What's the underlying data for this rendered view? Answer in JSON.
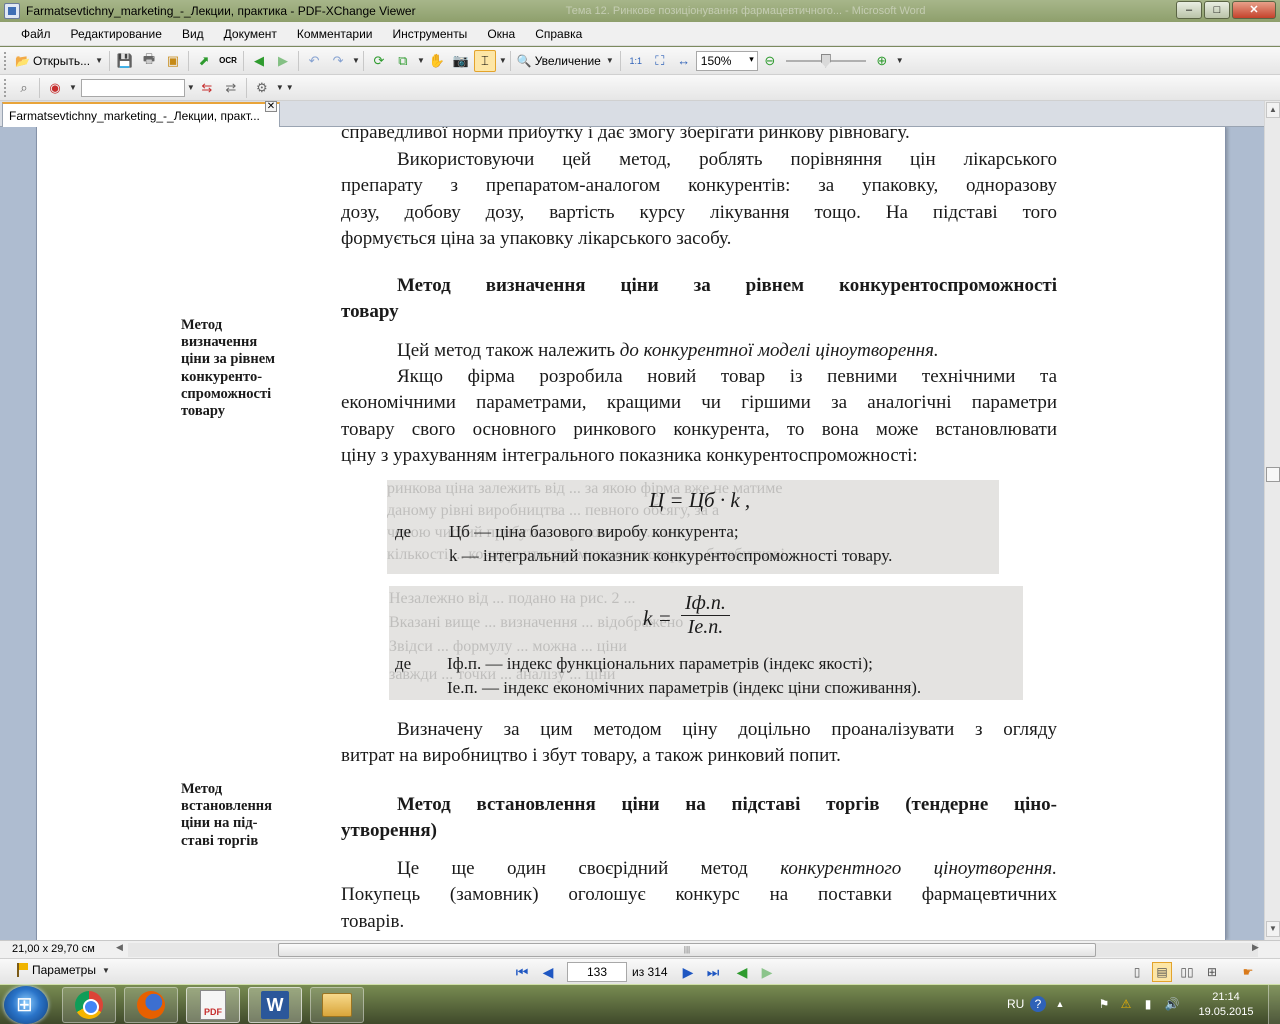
{
  "window": {
    "title": "Farmatsevtichny_marketing_-_Лекции, практика - PDF-XChange Viewer",
    "background_title": "Тема 12. Ринкове позиціонування фармацевтичного... - Microsoft Word",
    "buttons": {
      "minimize": "–",
      "maximize": "□",
      "close": "✕"
    }
  },
  "menu": [
    "Файл",
    "Редактирование",
    "Вид",
    "Документ",
    "Комментарии",
    "Инструменты",
    "Окна",
    "Справка"
  ],
  "toolbar": {
    "open_label": "Открыть...",
    "zoom_in_label": "Увеличение",
    "zoom_value": "150%",
    "zoom_slider_fraction": 0.5,
    "ocr_label": "OCR"
  },
  "tab": {
    "label": "Farmatsevtichny_marketing_-_Лекции, практ...",
    "close": "✕"
  },
  "document": {
    "top_line": "справедливої норми прибутку і дає змогу зберігати ринкову рівновагу.",
    "para1": [
      "Використовуючи цей метод, роблять порівняння цін лікарського",
      "препарату з препаратом-аналогом конкурентів: за упаковку, одноразову",
      "дозу, добову дозу, вартість курсу лікування тощо. На підставі того",
      "формується ціна за упаковку лікарського засобу."
    ],
    "heading1": [
      "Метод визначення ціни за рівнем конкурентоспроможності",
      "товару"
    ],
    "side1": [
      "Метод",
      "визначення",
      "ціни за рівнем",
      "конкуренто-",
      "спроможності",
      "товару"
    ],
    "para2_text": "Цей метод також належить ",
    "para2_italic": "до конкурентної моделі ціноутворення.",
    "para3": [
      "Якщо фірма розробила новий товар із певними технічними та",
      "економічними параметрами, кращими чи гіршими за аналогічні параметри",
      "товару свого основного ринкового конкурента, то вона може встановлювати",
      "ціну з урахуванням інтегрального показника конкурентоспроможності:"
    ],
    "formula1": {
      "main": "Ц = Цб · k ,",
      "de": "де",
      "line1": "Цб — ціна базового виробу конкурента;",
      "line2": "k — інтегральний показник конкурентоспроможності товару.",
      "ghost": [
        "ринкова ціна залежить від ... за якою фірма вже не матиме",
        "даному рівні виробництва ... певного обсягу, за а",
        "ченою чистий прибуток ... разом ... ат ... мо",
        "кількості ... конкурентоспроможного товару ... беззбиткові"
      ]
    },
    "formula2": {
      "k": "k =",
      "num": "Iф.п.",
      "den": "Iе.п.",
      "de": "де",
      "line1": "Iф.п. — індекс функціональних параметрів (індекс якості);",
      "line2": "Iе.п. — індекс економічних параметрів (індекс ціни споживання).",
      "ghost": [
        "Незалежно від ... подано на рис. 2 ...",
        "Вказані вище ... визначення ... відображено",
        "Звідси ... формулу ... можна ... ціни",
        "завжди ... точки ... аналізу ... ціни"
      ]
    },
    "para4": [
      "Визначену за цим методом ціну доцільно проаналізувати з огляду",
      "витрат на виробництво і збут товару, а також ринковий попит."
    ],
    "side2": [
      "Метод",
      "встановлення",
      "ціни на під-",
      "ставі торгів"
    ],
    "heading2": [
      "Метод встановлення ціни на підставі торгів (тендерне ціно-",
      "утворення)"
    ],
    "para5_line1_text": "Це ще один своєрідний метод ",
    "para5_line1_italic": "конкурентного ціноутворення.",
    "para5_rest": [
      "Покупець (замовник) оголошує конкурс на поставки фармацевтичних",
      "товарів."
    ]
  },
  "status": {
    "page_size": "21,00 x 29,70 см",
    "params_label": "Параметры",
    "page_current": "133",
    "page_total": "из 314"
  },
  "taskbar": {
    "lang": "RU",
    "time": "21:14",
    "date": "19.05.2015"
  }
}
